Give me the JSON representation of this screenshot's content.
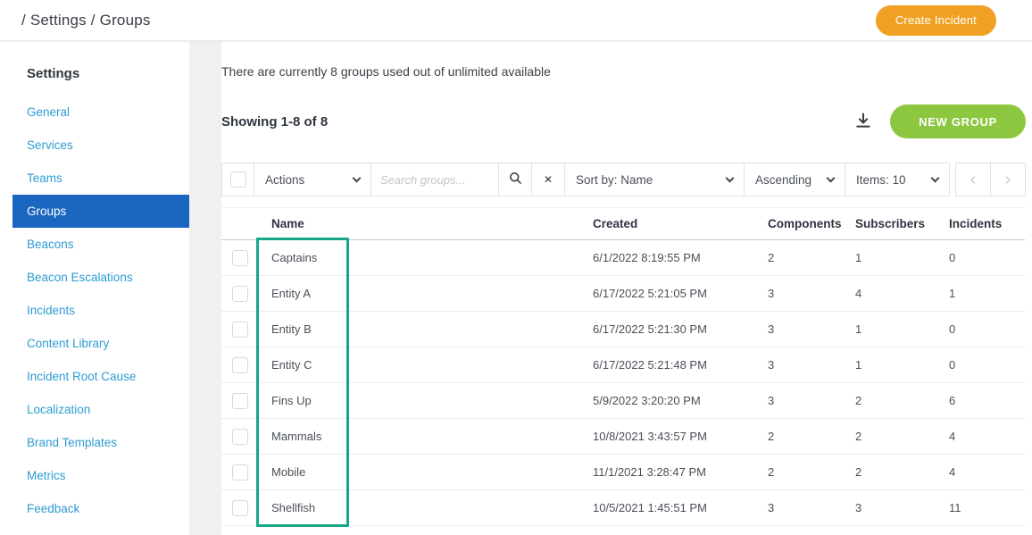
{
  "header": {
    "breadcrumb": "/ Settings / Groups",
    "create_incident_label": "Create Incident"
  },
  "sidebar": {
    "title": "Settings",
    "items": [
      {
        "label": "General",
        "active": false
      },
      {
        "label": "Services",
        "active": false
      },
      {
        "label": "Teams",
        "active": false
      },
      {
        "label": "Groups",
        "active": true
      },
      {
        "label": "Beacons",
        "active": false
      },
      {
        "label": "Beacon Escalations",
        "active": false
      },
      {
        "label": "Incidents",
        "active": false
      },
      {
        "label": "Content Library",
        "active": false
      },
      {
        "label": "Incident Root Cause",
        "active": false
      },
      {
        "label": "Localization",
        "active": false
      },
      {
        "label": "Brand Templates",
        "active": false
      },
      {
        "label": "Metrics",
        "active": false
      },
      {
        "label": "Feedback",
        "active": false
      }
    ]
  },
  "main": {
    "summary": "There are currently 8 groups used out of unlimited available",
    "showing": "Showing 1-8 of 8",
    "new_group_label": "NEW GROUP",
    "toolbar": {
      "actions_label": "Actions",
      "search_placeholder": "Search groups...",
      "search_icon": "magnifier-icon",
      "clear_icon": "✕",
      "sort_label": "Sort by: Name",
      "order_label": "Ascending",
      "items_label": "Items: 10",
      "prev_icon": "‹",
      "next_icon": "›"
    },
    "table": {
      "columns": [
        "Name",
        "Created",
        "Components",
        "Subscribers",
        "Incidents"
      ],
      "rows": [
        {
          "name": "Captains",
          "created": "6/1/2022 8:19:55 PM",
          "components": "2",
          "subscribers": "1",
          "incidents": "0"
        },
        {
          "name": "Entity A",
          "created": "6/17/2022 5:21:05 PM",
          "components": "3",
          "subscribers": "4",
          "incidents": "1"
        },
        {
          "name": "Entity B",
          "created": "6/17/2022 5:21:30 PM",
          "components": "3",
          "subscribers": "1",
          "incidents": "0"
        },
        {
          "name": "Entity C",
          "created": "6/17/2022 5:21:48 PM",
          "components": "3",
          "subscribers": "1",
          "incidents": "0"
        },
        {
          "name": "Fins Up",
          "created": "5/9/2022 3:20:20 PM",
          "components": "3",
          "subscribers": "2",
          "incidents": "6"
        },
        {
          "name": "Mammals",
          "created": "10/8/2021 3:43:57 PM",
          "components": "2",
          "subscribers": "2",
          "incidents": "4"
        },
        {
          "name": "Mobile",
          "created": "11/1/2021 3:28:47 PM",
          "components": "2",
          "subscribers": "2",
          "incidents": "4"
        },
        {
          "name": "Shellfish",
          "created": "10/5/2021 1:45:51 PM",
          "components": "3",
          "subscribers": "3",
          "incidents": "11"
        }
      ]
    }
  },
  "colors": {
    "active_item_blue": "#1a66c0",
    "link_blue": "#2e9bd2",
    "create_incident_orange": "#f0a124",
    "new_group_green": "#8dc63f",
    "annotation_teal": "#17a689"
  }
}
